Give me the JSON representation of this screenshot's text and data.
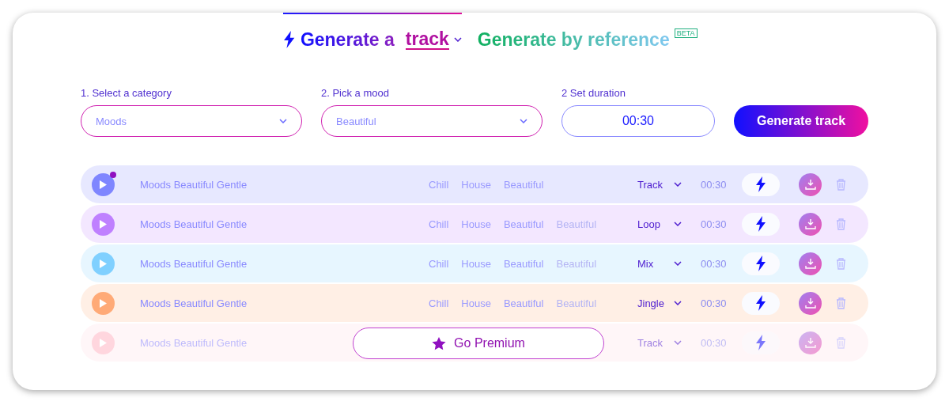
{
  "tabs": [
    {
      "label": "Generate a",
      "selector": "track",
      "selected": true
    },
    {
      "label": "Generate by reference",
      "badge": "BETA",
      "selected": false
    }
  ],
  "fields": [
    {
      "kind": "select",
      "label": "1. Select a category",
      "value": "Moods"
    },
    {
      "kind": "select",
      "label": "2. Pick a mood",
      "value": "Beautiful"
    },
    {
      "kind": "input",
      "label": "2 Set duration",
      "value": "00:30"
    }
  ],
  "generate_button": "Generate track",
  "tracks": [
    {
      "title": "Moods Beautiful Gentle",
      "color": "#7f86ff",
      "new": true,
      "faded": false,
      "tags": [
        {
          "label": "Chill",
          "faded": false
        },
        {
          "label": "House",
          "faded": false
        },
        {
          "label": "Beautiful",
          "faded": false
        }
      ],
      "type": "Track",
      "duration": "00:30"
    },
    {
      "title": "Moods Beautiful Gentle",
      "color": "#bf80ff",
      "new": false,
      "faded": false,
      "tags": [
        {
          "label": "Chill",
          "faded": false
        },
        {
          "label": "House",
          "faded": false
        },
        {
          "label": "Beautiful",
          "faded": false
        },
        {
          "label": "Beautiful",
          "faded": true
        }
      ],
      "type": "Loop",
      "duration": "00:30"
    },
    {
      "title": "Moods Beautiful Gentle",
      "color": "#80d0ff",
      "new": false,
      "faded": false,
      "tags": [
        {
          "label": "Chill",
          "faded": false
        },
        {
          "label": "House",
          "faded": false
        },
        {
          "label": "Beautiful",
          "faded": false
        },
        {
          "label": "Beautiful",
          "faded": true
        }
      ],
      "type": "Mix",
      "duration": "00:30"
    },
    {
      "title": "Moods Beautiful Gentle",
      "color": "#ffaa77",
      "new": false,
      "faded": false,
      "tags": [
        {
          "label": "Chill",
          "faded": false
        },
        {
          "label": "House",
          "faded": false
        },
        {
          "label": "Beautiful",
          "faded": false
        },
        {
          "label": "Beautiful",
          "faded": true
        }
      ],
      "type": "Jingle",
      "duration": "00:30"
    },
    {
      "title": "Moods Beautiful Gentle",
      "color": "#ffd6de",
      "new": false,
      "faded": true,
      "type": "Track",
      "duration": "00:30"
    }
  ],
  "premium_button": "Go Premium"
}
